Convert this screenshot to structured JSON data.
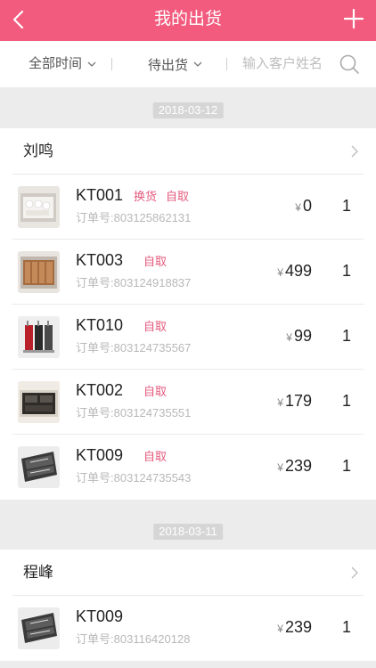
{
  "header": {
    "title": "我的出货",
    "back_icon": "chevron-left-icon",
    "add_icon": "plus-icon"
  },
  "filters": {
    "time_label": "全部时间",
    "status_label": "待出货",
    "search_placeholder": "输入客户姓名"
  },
  "groups": [
    {
      "date": "2018-03-12",
      "customer": "刘鸣",
      "items": [
        {
          "code": "KT001",
          "tags": [
            "换货",
            "自取"
          ],
          "order_label": "订单号:",
          "order_no": "803125862131",
          "price": "0",
          "qty": "1",
          "thumb": "white-tableware-drawer"
        },
        {
          "code": "KT003",
          "tags": [
            "自取"
          ],
          "order_label": "订单号:",
          "order_no": "803124918837",
          "price": "499",
          "qty": "1",
          "thumb": "wooden-utensil-drawer"
        },
        {
          "code": "KT010",
          "tags": [
            "自取"
          ],
          "order_label": "订单号:",
          "order_no": "803124735567",
          "price": "99",
          "qty": "1",
          "thumb": "knife-block"
        },
        {
          "code": "KT002",
          "tags": [
            "自取"
          ],
          "order_label": "订单号:",
          "order_no": "803124735551",
          "price": "179",
          "qty": "1",
          "thumb": "dark-tray-drawer"
        },
        {
          "code": "KT009",
          "tags": [
            "自取"
          ],
          "order_label": "订单号:",
          "order_no": "803124735543",
          "price": "239",
          "qty": "1",
          "thumb": "cutlery-organizer"
        }
      ]
    },
    {
      "date": "2018-03-11",
      "customer": "程峰",
      "items": [
        {
          "code": "KT009",
          "tags": [],
          "order_label": "订单号:",
          "order_no": "803116420128",
          "price": "239",
          "qty": "1",
          "thumb": "cutlery-organizer"
        }
      ]
    }
  ],
  "currency_symbol": "¥",
  "colors": {
    "accent": "#f25b7e",
    "tag": "#e45a7d"
  }
}
